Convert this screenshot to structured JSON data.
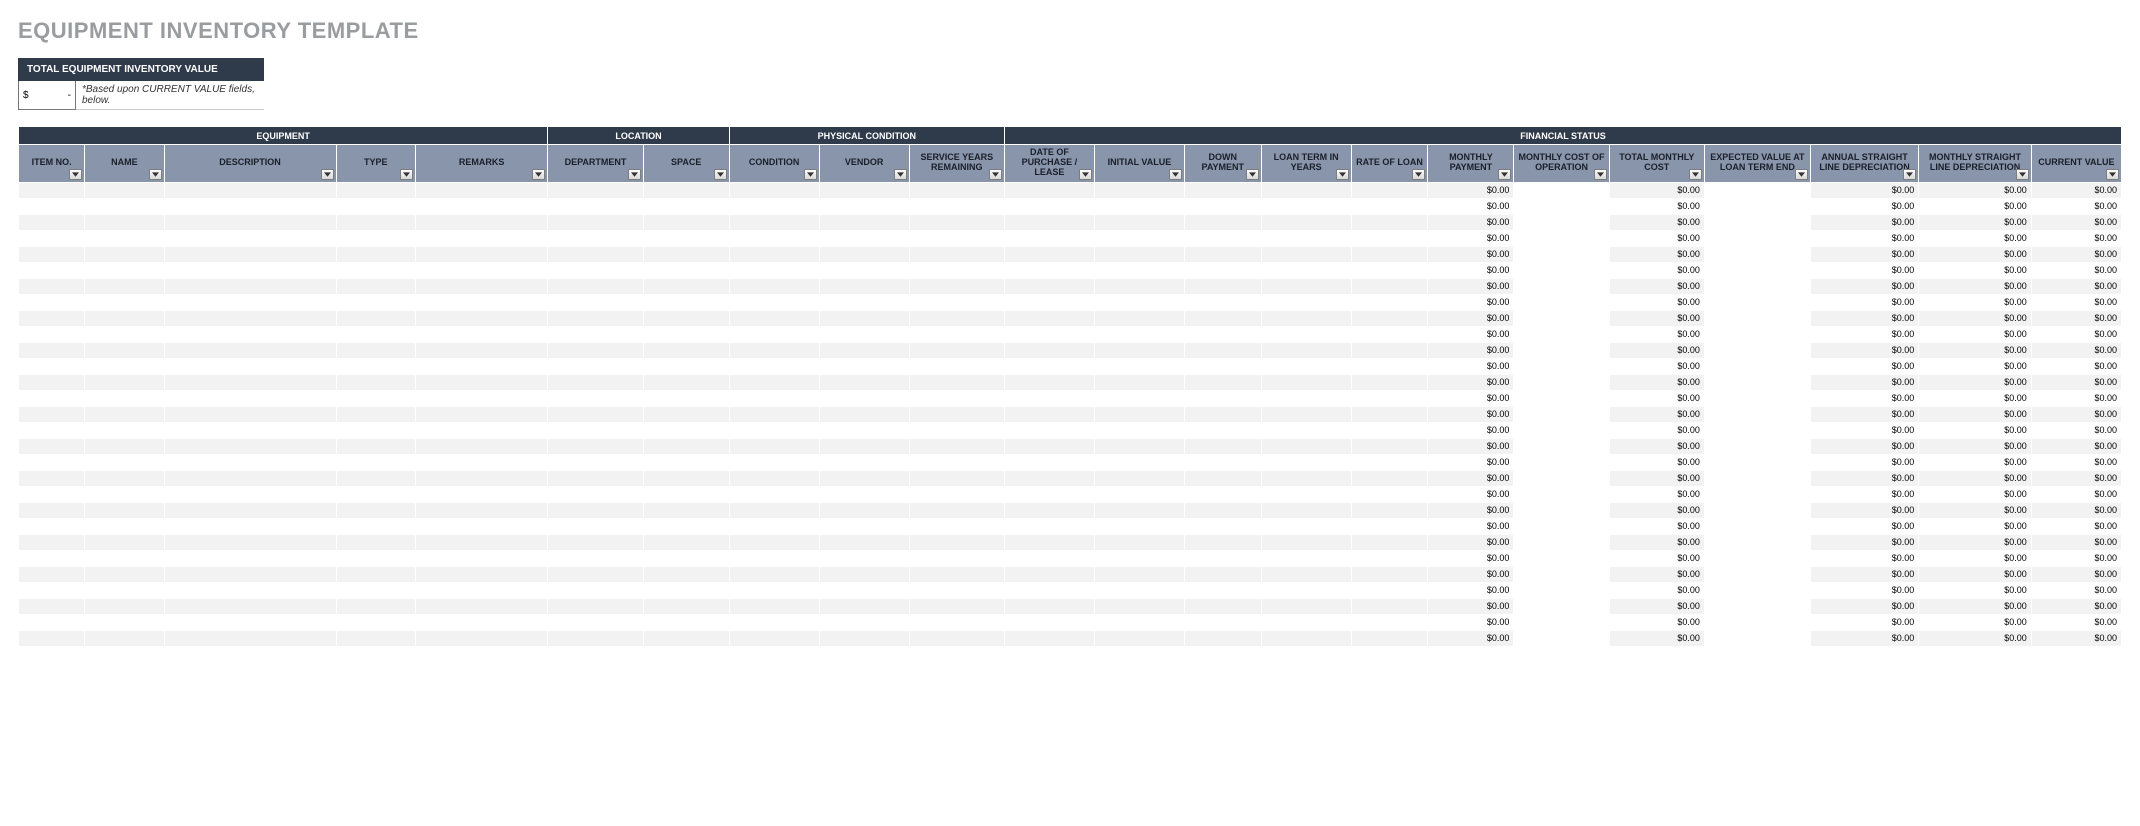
{
  "title": "EQUIPMENT INVENTORY TEMPLATE",
  "summary": {
    "header": "TOTAL EQUIPMENT INVENTORY VALUE",
    "currency": "$",
    "amount": "-",
    "note": "*Based upon CURRENT VALUE fields, below."
  },
  "groups": {
    "equipment": "EQUIPMENT",
    "location": "LOCATION",
    "physical": "PHYSICAL CONDITION",
    "financial": "FINANCIAL STATUS"
  },
  "columns": {
    "item_no": "ITEM NO.",
    "name": "NAME",
    "description": "DESCRIPTION",
    "type": "TYPE",
    "remarks": "REMARKS",
    "department": "DEPARTMENT",
    "space": "SPACE",
    "condition": "CONDITION",
    "vendor": "VENDOR",
    "service_years": "SERVICE YEARS REMAINING",
    "date_purchase": "DATE OF PURCHASE / LEASE",
    "initial_value": "INITIAL VALUE",
    "down_payment": "DOWN PAYMENT",
    "loan_term": "LOAN TERM IN YEARS",
    "rate_of_loan": "RATE OF LOAN",
    "monthly_payment": "MONTHLY PAYMENT",
    "monthly_cost_op": "MONTHLY COST OF OPERATION",
    "total_monthly_cost": "TOTAL MONTHLY COST",
    "expected_value": "EXPECTED VALUE AT LOAN TERM END",
    "annual_sl_dep": "ANNUAL STRAIGHT LINE DEPRECIATION",
    "monthly_sl_dep": "MONTHLY STRAIGHT LINE DEPRECIATION",
    "current_value": "CURRENT VALUE"
  },
  "zero": "$0.00",
  "row_count": 29
}
